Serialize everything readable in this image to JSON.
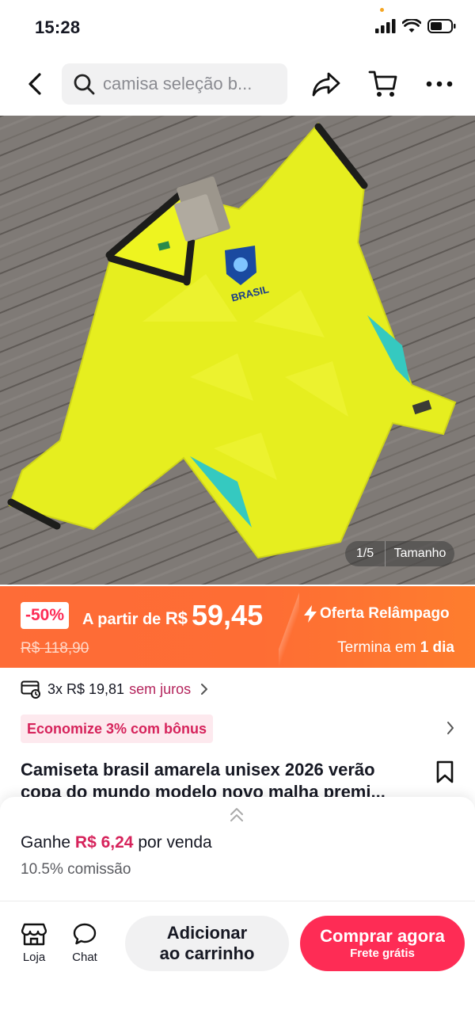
{
  "status_bar": {
    "time": "15:28"
  },
  "search": {
    "query": "camisa seleção b..."
  },
  "gallery": {
    "current": "1/5",
    "size_label": "Tamanho"
  },
  "price": {
    "discount": "-50%",
    "prefix": "A partir de",
    "currency": "R$",
    "value": "59,45",
    "old_price": "R$ 118,90",
    "flash_label": "Oferta Relâmpago",
    "ends_prefix": "Termina em",
    "ends_value": "1 dia"
  },
  "installments": {
    "text": "3x R$ 19,81",
    "interest": "sem juros"
  },
  "bonus": {
    "label": "Economize 3% com bônus"
  },
  "product": {
    "title": "Camiseta brasil amarela unisex 2026 verão copa do mundo modelo novo malha premi..."
  },
  "affiliate": {
    "earn_prefix": "Ganhe",
    "earn_amount": "R$ 6,24",
    "earn_suffix": "por venda",
    "commission": "10.5% comissão"
  },
  "actions": {
    "store": "Loja",
    "chat": "Chat",
    "add_to_cart_line1": "Adicionar",
    "add_to_cart_line2": "ao carrinho",
    "buy_now": "Comprar agora",
    "buy_now_sub": "Frete grátis"
  },
  "colors": {
    "accent": "#fe2c55",
    "banner": "#fe6c37",
    "bonus_text": "#d6235b",
    "shirt": "#e8ef1c"
  },
  "icons": [
    "back-icon",
    "search-icon",
    "share-icon",
    "cart-icon",
    "more-icon",
    "card-icon",
    "chevron-right-icon",
    "bookmark-icon",
    "store-icon",
    "chat-icon",
    "lightning-icon",
    "double-chevron-up-icon"
  ]
}
